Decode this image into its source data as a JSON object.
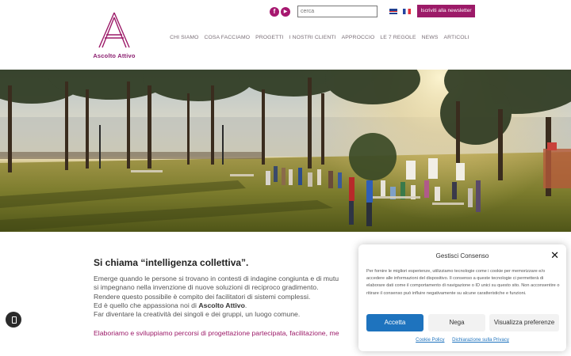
{
  "header": {
    "logo_text": "Ascolto Attivo",
    "social": {
      "facebook": "f",
      "youtube": "▶"
    },
    "search": {
      "placeholder": "cerca"
    },
    "newsletter_label": "Iscriviti alla newsletter",
    "brand_color": "#9c1a68"
  },
  "nav": {
    "items": [
      "CHI SIAMO",
      "COSA FACCIAMO",
      "PROGETTI",
      "I NOSTRI CLIENTI",
      "APPROCCIO",
      "LE 7 REGOLE",
      "NEWS",
      "ARTICOLI"
    ]
  },
  "hero": {
    "image": "photo of people gathered in a park under trees at sunset"
  },
  "content": {
    "headline": "Si chiama “intelligenza collettiva”.",
    "lines": [
      "Emerge quando le persone si trovano in contesti di indagine congiunta e di mutu",
      "si impegnano nella invenzione di nuove soluzioni di reciproco gradimento.",
      "Rendere questo possibile è compito dei facilitatori di sistemi complessi.",
      "Ed è quello che appassiona noi di ",
      "Far diventare la creatività dei singoli e dei gruppi, un luogo comune."
    ],
    "bold_name": "Ascolto Attivo",
    "line4_end": ".",
    "accent_line": "Elaboriamo e sviluppiamo percorsi di progettazione partecipata, facilitazione, me"
  },
  "cookie": {
    "title": "Gestisci Consenso",
    "text": "Per fornire le migliori esperienze, utilizziamo tecnologie come i cookie per memorizzare e/o accedere alle informazioni del dispositivo. Il consenso a queste tecnologie ci permetterà di elaborare dati come il comportamento di navigazione o ID unici su questo sito. Non acconsentire o ritirare il consenso può influire negativamente su alcune caratteristiche e funzioni.",
    "accept": "Accetta",
    "deny": "Nega",
    "preferences": "Visualizza preferenze",
    "cookie_policy": "Cookie Policy",
    "privacy": "Dichiarazione sulla Privacy",
    "accent_color": "#1e73be"
  }
}
